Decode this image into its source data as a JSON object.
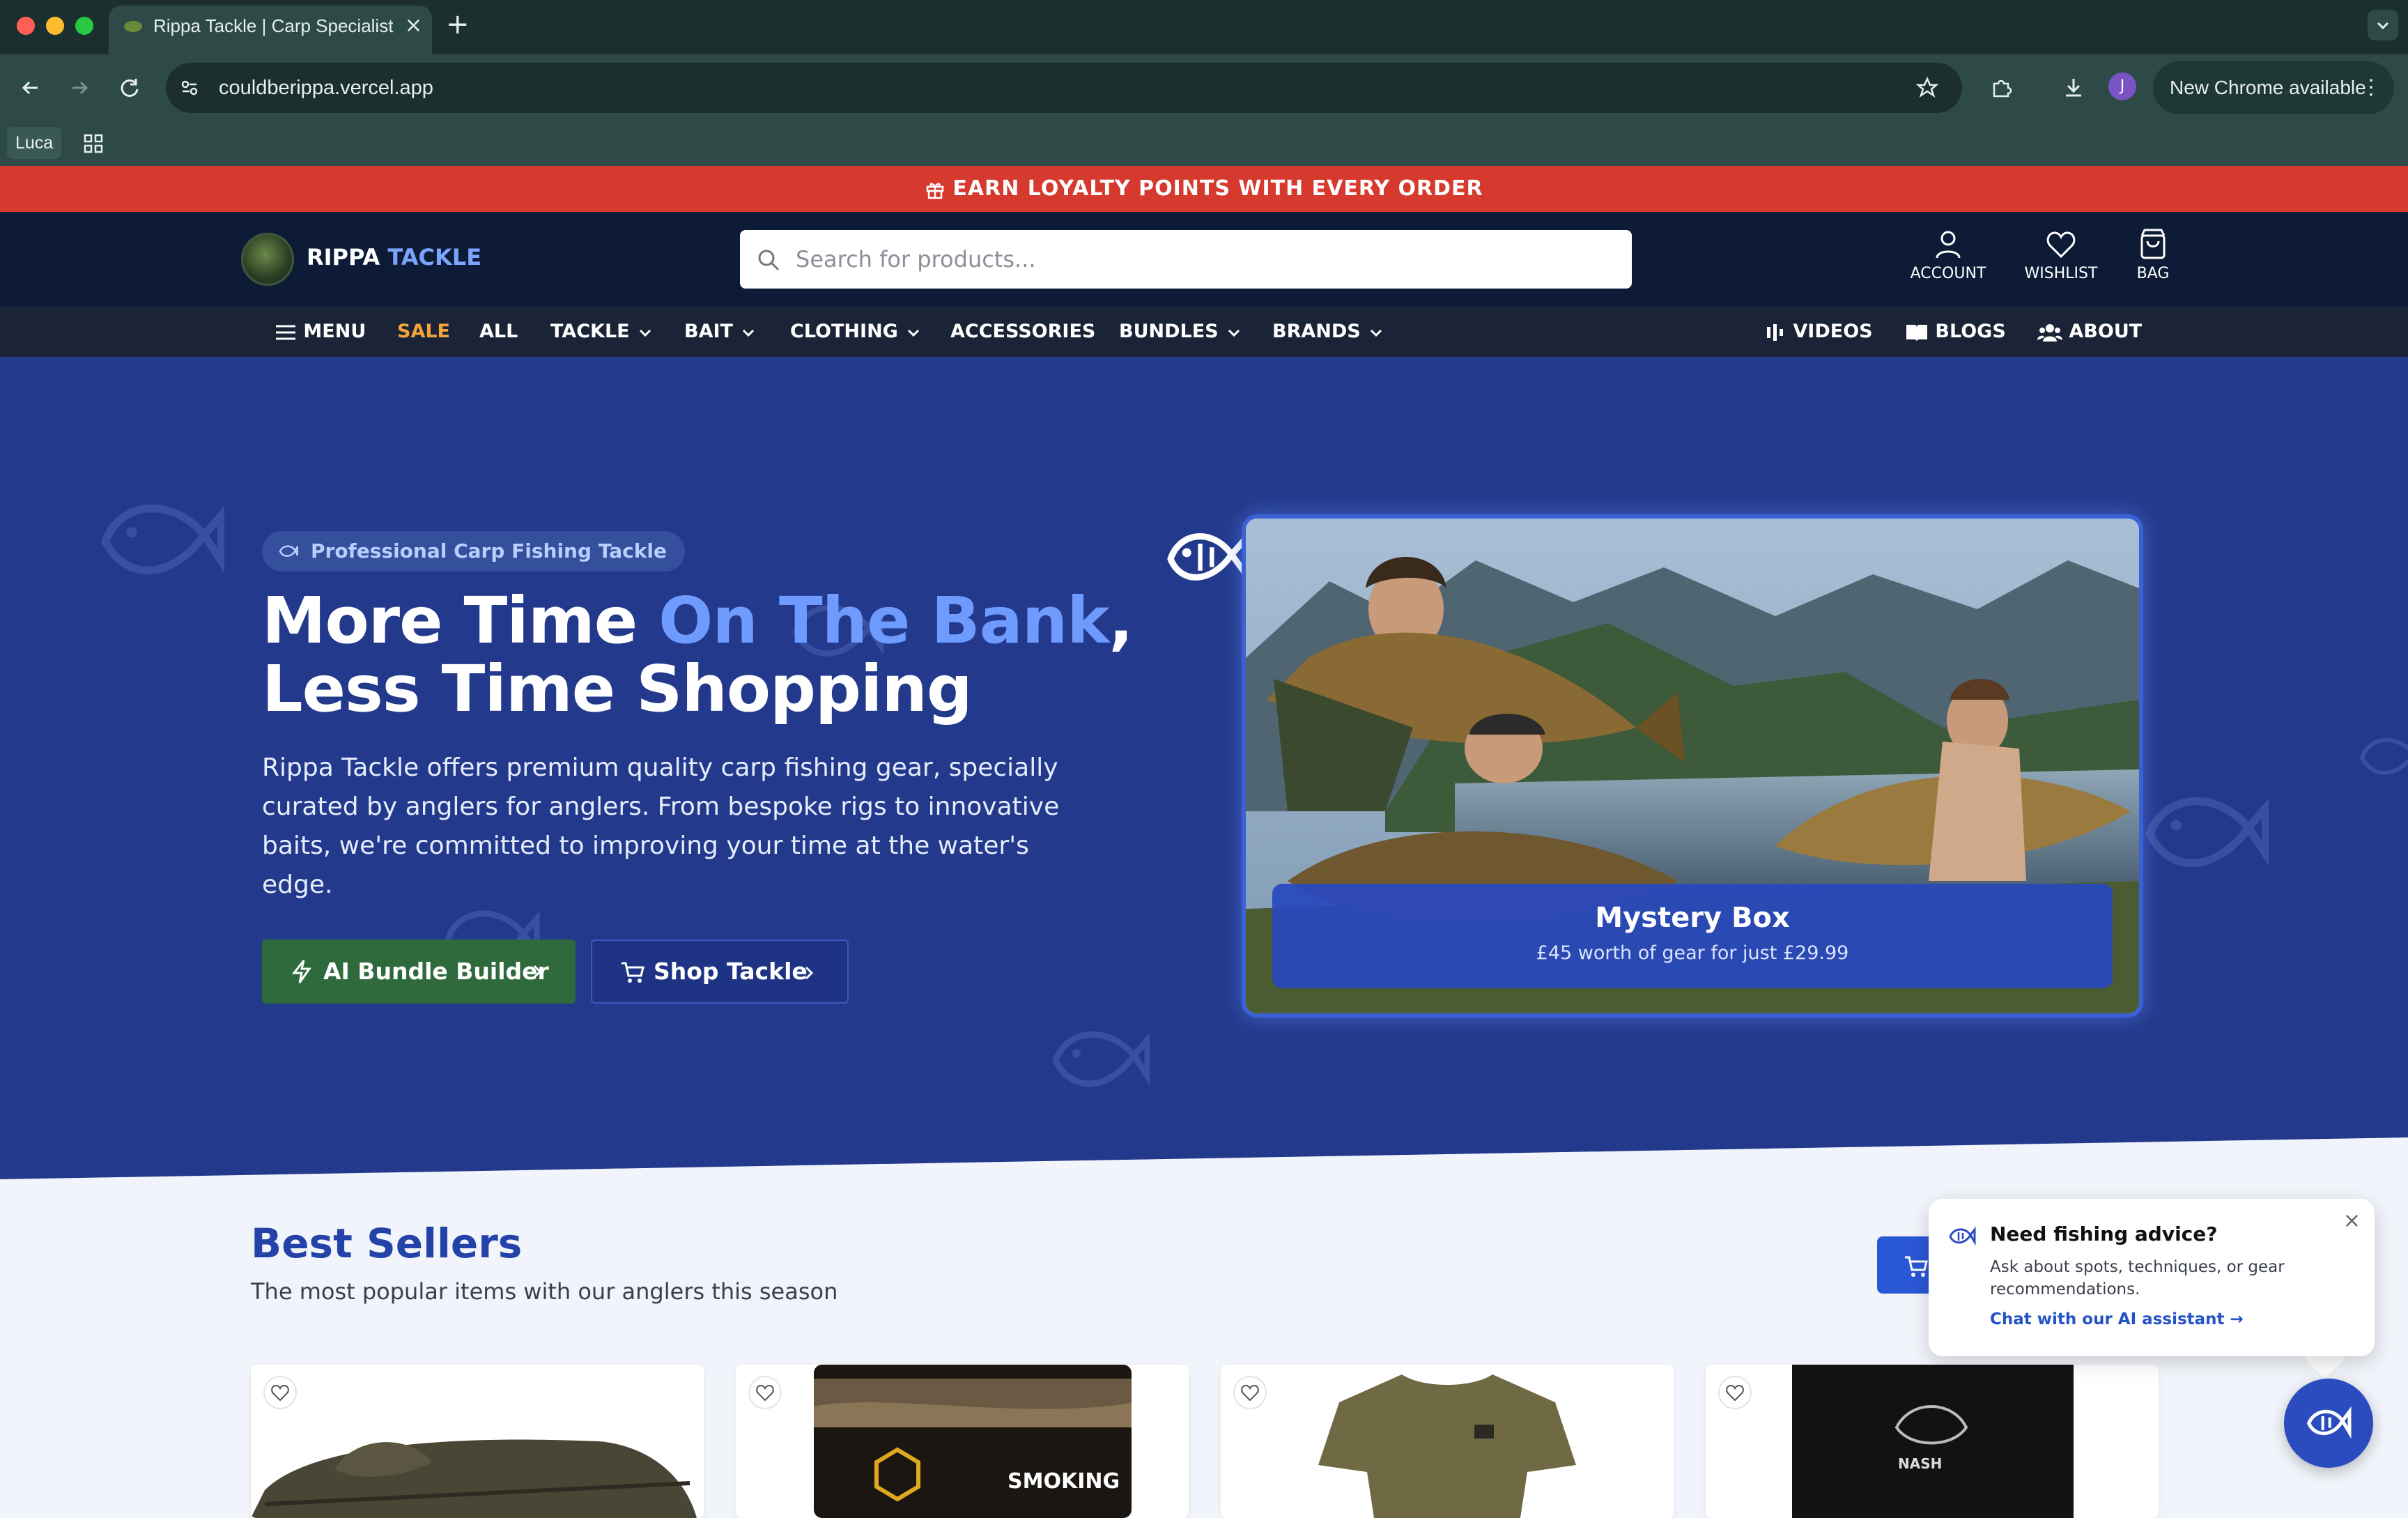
{
  "browser": {
    "tab_title": "Rippa Tackle | Carp Specialist",
    "url": "couldberippa.vercel.app",
    "new_chrome": "New Chrome available",
    "profile_initial": "J",
    "bookmark": "Luca"
  },
  "promo": {
    "text": "EARN LOYALTY POINTS WITH EVERY ORDER"
  },
  "header": {
    "logo_a": "RIPPA",
    "logo_b": " TACKLE",
    "search_placeholder": "Search for products...",
    "account": "ACCOUNT",
    "wishlist": "WISHLIST",
    "bag": "BAG"
  },
  "nav": {
    "menu": "MENU",
    "sale": "SALE",
    "all": "ALL",
    "tackle": "TACKLE",
    "bait": "BAIT",
    "clothing": "CLOTHING",
    "accessories": "ACCESSORIES",
    "bundles": "BUNDLES",
    "brands": "BRANDS",
    "videos": "VIDEOS",
    "blogs": "BLOGS",
    "about": "ABOUT"
  },
  "hero": {
    "badge": "Professional Carp Fishing Tackle",
    "headline_a": "More Time ",
    "headline_hl": "On The Bank",
    "headline_b": ",",
    "headline_c": "Less Time Shopping",
    "description": "Rippa Tackle offers premium quality carp fishing gear, specially curated by anglers for anglers. From bespoke rigs to innovative baits, we're committed to improving your time at the water's edge.",
    "btn_ai": "AI Bundle Builder",
    "btn_shop": "Shop Tackle",
    "mystery_title": "Mystery Box",
    "mystery_sub": "£45 worth of gear for just £29.99"
  },
  "best_sellers": {
    "title": "Best Sellers",
    "subtitle": "The most popular items with our anglers this season",
    "jar_label": "SMOKING",
    "bag_label": "NASH"
  },
  "chat": {
    "title": "Need fishing advice?",
    "body": "Ask about spots, techniques, or gear recommendations.",
    "link": "Chat with our AI assistant →"
  },
  "colors": {
    "promo": "#d63a2e",
    "header": "#0d1b36",
    "hero": "#233a8c",
    "accent": "#6f9bff",
    "ai_button": "#2f6a3c"
  }
}
